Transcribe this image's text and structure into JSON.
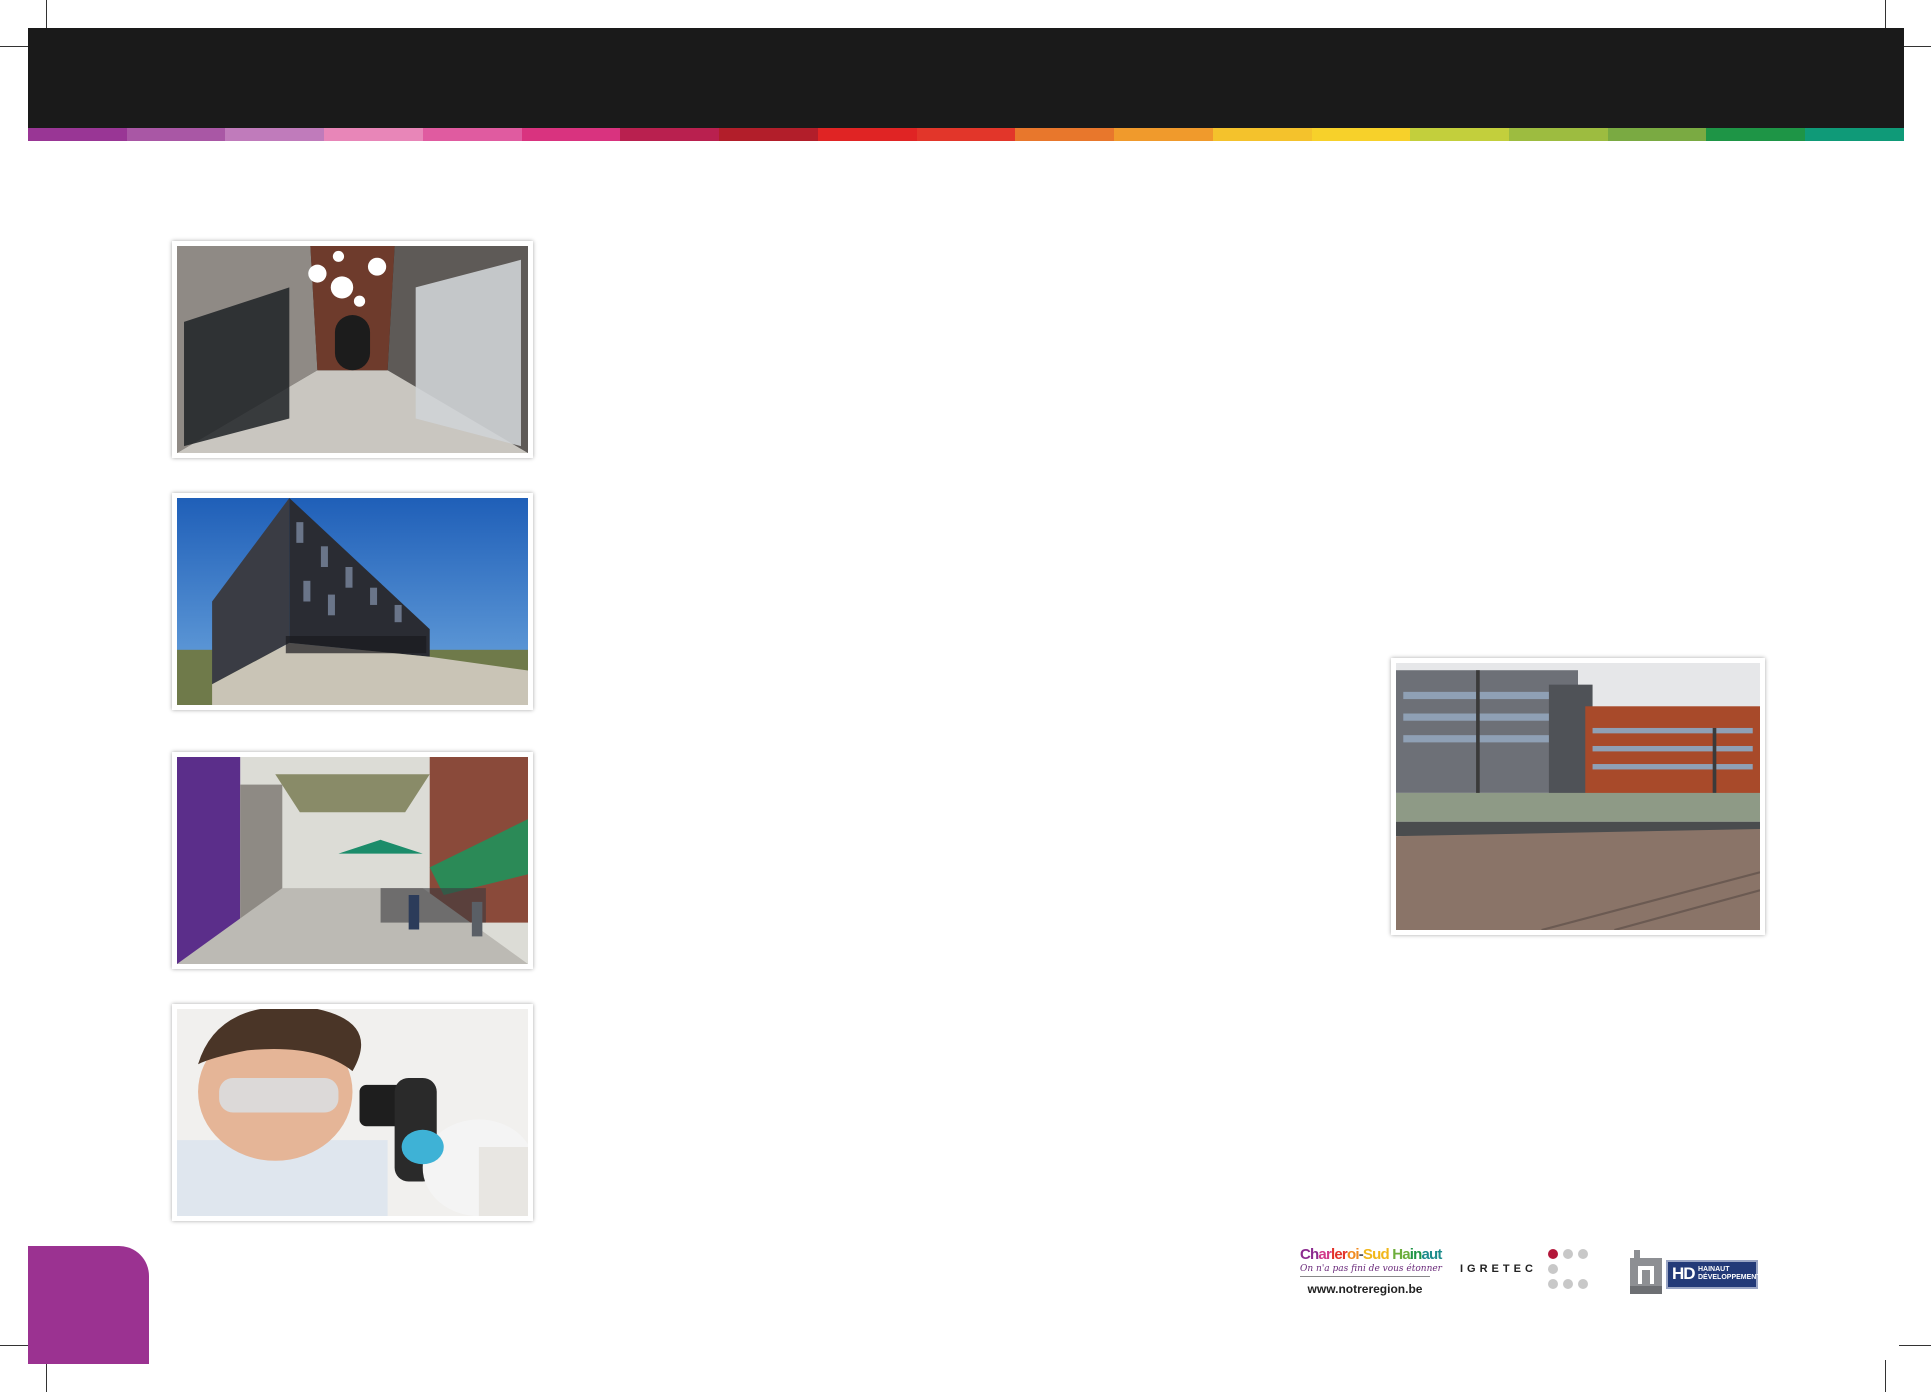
{
  "stripe_colors": [
    "#993695",
    "#a957a5",
    "#c07bbb",
    "#e886b8",
    "#e05ba0",
    "#d9337f",
    "#b9204f",
    "#b21e2a",
    "#e02424",
    "#e2362a",
    "#e8772c",
    "#f09a2c",
    "#f4c22c",
    "#f7d12a",
    "#c3cf3c",
    "#9dbc40",
    "#7aaa42",
    "#1e9546",
    "#0f9a78"
  ],
  "accent_color": "#9b3291",
  "photos": [
    {
      "name": "interior-corridor-photo"
    },
    {
      "name": "modern-building-photo"
    },
    {
      "name": "pedestrian-street-photo"
    },
    {
      "name": "scientist-microscope-photo"
    },
    {
      "name": "office-buildings-tram-photo"
    }
  ],
  "footer": {
    "charleroi": {
      "name_parts": [
        "Ch",
        "ar",
        "ler",
        "oi",
        "-",
        "Sud ",
        "Ha",
        "in",
        "aut"
      ],
      "part_colors": [
        "#8c2b8f",
        "#d23a8a",
        "#e3342a",
        "#f08a1f",
        "#555555",
        "#f1b71a",
        "#6dae3c",
        "#1e9546",
        "#1d8c8c"
      ],
      "tagline": "On n'a pas fini de vous étonner",
      "url": "www.notreregion.be"
    },
    "igretec": {
      "label": "IGRETEC"
    },
    "hainaut": {
      "letters": "HD",
      "name": "HAINAUT\nDÉVELOPPEMENT"
    }
  }
}
